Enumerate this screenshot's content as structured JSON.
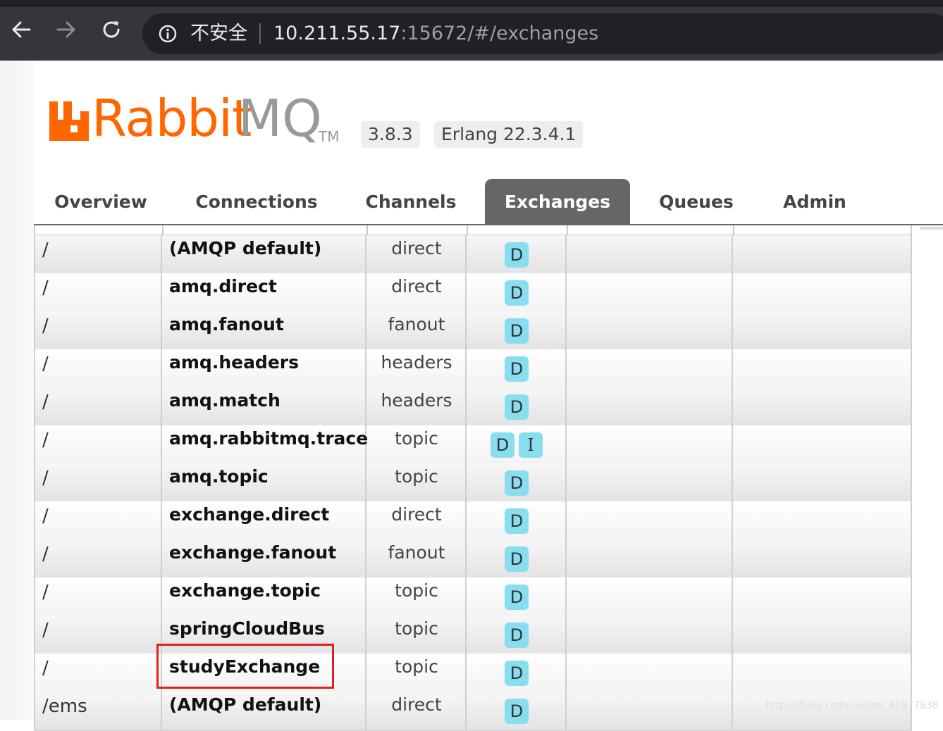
{
  "browser": {
    "security_label": "不安全",
    "url_host": "10.211.55.17",
    "url_path": ":15672/#/exchanges"
  },
  "header": {
    "logo_rabbit": "Rabbit",
    "logo_mq": "MQ",
    "logo_tm": "TM",
    "version": "3.8.3",
    "erlang": "Erlang 22.3.4.1"
  },
  "tabs": [
    {
      "label": "Overview"
    },
    {
      "label": "Connections"
    },
    {
      "label": "Channels"
    },
    {
      "label": "Exchanges",
      "active": true
    },
    {
      "label": "Queues"
    },
    {
      "label": "Admin"
    }
  ],
  "exchanges": [
    {
      "vhost": "/",
      "name": "(AMQP default)",
      "type": "direct",
      "features": [
        "D"
      ]
    },
    {
      "vhost": "/",
      "name": "amq.direct",
      "type": "direct",
      "features": [
        "D"
      ]
    },
    {
      "vhost": "/",
      "name": "amq.fanout",
      "type": "fanout",
      "features": [
        "D"
      ]
    },
    {
      "vhost": "/",
      "name": "amq.headers",
      "type": "headers",
      "features": [
        "D"
      ]
    },
    {
      "vhost": "/",
      "name": "amq.match",
      "type": "headers",
      "features": [
        "D"
      ]
    },
    {
      "vhost": "/",
      "name": "amq.rabbitmq.trace",
      "type": "topic",
      "features": [
        "D",
        "I"
      ]
    },
    {
      "vhost": "/",
      "name": "amq.topic",
      "type": "topic",
      "features": [
        "D"
      ]
    },
    {
      "vhost": "/",
      "name": "exchange.direct",
      "type": "direct",
      "features": [
        "D"
      ]
    },
    {
      "vhost": "/",
      "name": "exchange.fanout",
      "type": "fanout",
      "features": [
        "D"
      ]
    },
    {
      "vhost": "/",
      "name": "exchange.topic",
      "type": "topic",
      "features": [
        "D"
      ]
    },
    {
      "vhost": "/",
      "name": "springCloudBus",
      "type": "topic",
      "features": [
        "D"
      ]
    },
    {
      "vhost": "/",
      "name": "studyExchange",
      "type": "topic",
      "features": [
        "D"
      ]
    },
    {
      "vhost": "/ems",
      "name": "(AMQP default)",
      "type": "direct",
      "features": [
        "D"
      ]
    }
  ],
  "watermark": "https://blog.csdn.net/qq_41977838",
  "colors": {
    "brand_orange": "#ff6600",
    "feature_badge": "#88ddee",
    "active_tab": "#666666",
    "highlight_border": "#e02020"
  },
  "icons": [
    "back-arrow-icon",
    "forward-arrow-icon",
    "reload-icon",
    "info-icon"
  ]
}
